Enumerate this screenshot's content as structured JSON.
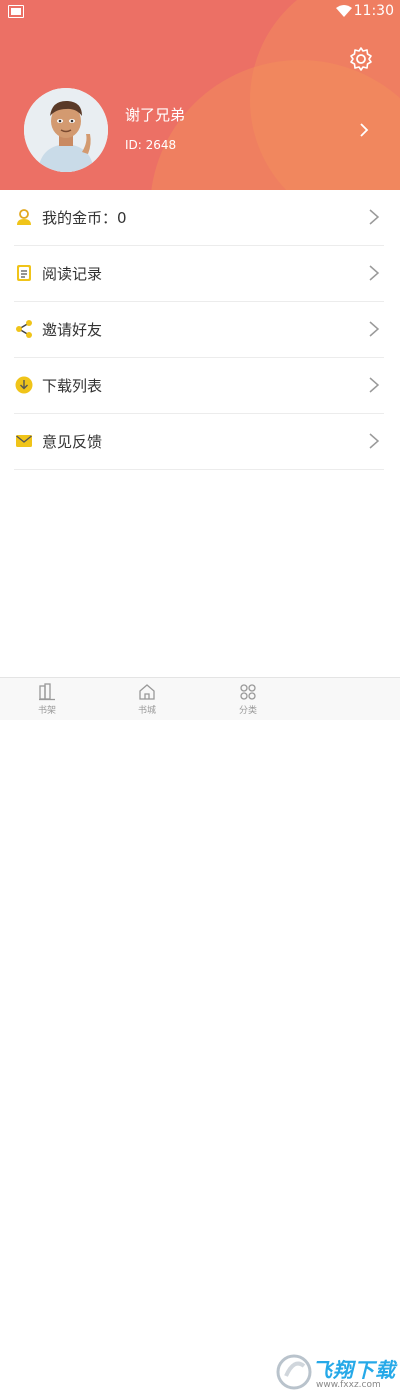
{
  "status_bar": {
    "time": "11:30"
  },
  "profile": {
    "username": "谢了兄弟",
    "user_id": "ID: 2648"
  },
  "menu": [
    {
      "label": "我的金币：0",
      "icon": "user-icon"
    },
    {
      "label": "阅读记录",
      "icon": "document-icon"
    },
    {
      "label": "邀请好友",
      "icon": "share-icon"
    },
    {
      "label": "下载列表",
      "icon": "download-icon"
    },
    {
      "label": "意见反馈",
      "icon": "mail-icon"
    }
  ],
  "tabs": [
    {
      "label": "书架",
      "icon": "bookshelf-icon"
    },
    {
      "label": "书城",
      "icon": "home-icon"
    },
    {
      "label": "分类",
      "icon": "grid-icon"
    }
  ],
  "watermark": {
    "text": "飞翔下载",
    "sub": "www.fxxz.com"
  },
  "colors": {
    "header": "#ec7065",
    "accent": "#f0c419",
    "tab_active": "#e85d52"
  }
}
